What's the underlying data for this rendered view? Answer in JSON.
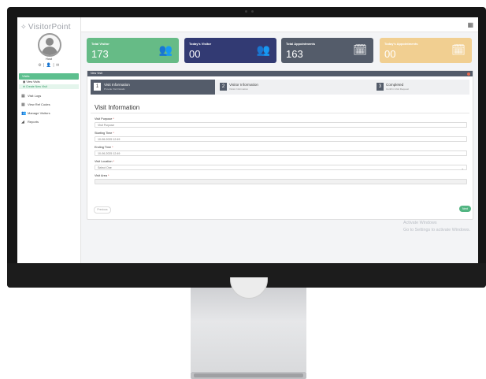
{
  "app": {
    "logo_text": "VisitorPoint",
    "logo_mark": "✧"
  },
  "user": {
    "name": "Host",
    "icons_text": "⚙ | 👤 | ✉"
  },
  "sidebar": {
    "active_label": "Visits",
    "sub_items": [
      {
        "label": "▦ View Visits"
      },
      {
        "label": "⊕ Create New Visit"
      }
    ],
    "items": [
      {
        "label": "Visit Logs",
        "icon": "▦"
      },
      {
        "label": "View Ref Codes",
        "icon": "▦"
      },
      {
        "label": "Manage Visitors",
        "icon": "👥"
      },
      {
        "label": "Reports",
        "icon": "◢"
      }
    ]
  },
  "topbar": {
    "grid_icon": "▦"
  },
  "stats": [
    {
      "label": "Total Visitor",
      "value": "173",
      "icon": "👥",
      "color": "#66bb86"
    },
    {
      "label": "Today's Visitor",
      "value": "00",
      "icon": "👥",
      "color": "#323a73"
    },
    {
      "label": "Total Appointments",
      "value": "163",
      "icon": "🗓",
      "color": "#545c6a"
    },
    {
      "label": "Today's Appointments",
      "value": "00",
      "icon": "🗓",
      "color": "#f1cf91"
    }
  ],
  "panel": {
    "title": "New Visit",
    "steps": [
      {
        "num": "1",
        "title": "Visit Information",
        "subtitle": "Provide Visit Details"
      },
      {
        "num": "2",
        "title": "Visitor Information",
        "subtitle": "Visitor Information"
      },
      {
        "num": "3",
        "title": "Completed",
        "subtitle": "Confirm Visit Request"
      }
    ],
    "form_title": "Visit Information",
    "fields": [
      {
        "label": "Visit Purpose",
        "value": "Visit Purpose"
      },
      {
        "label": "Starting Time",
        "value": "10-06-2025 12:49"
      },
      {
        "label": "Ending Time",
        "value": "10-06-2025 12:49"
      },
      {
        "label": "Visit Location",
        "value": "Select One"
      },
      {
        "label": "Visit Area",
        "value": ""
      }
    ],
    "required_mark": "*",
    "prev_label": "Previous",
    "next_label": "Next"
  },
  "watermark": {
    "line1": "Activate Windows",
    "line2": "Go to Settings to activate Windows."
  },
  "colors": {
    "accent_green": "#66bb86",
    "navy": "#323a73",
    "slate": "#545c6a",
    "sand": "#f1cf91",
    "close_red": "#e66a4f"
  }
}
